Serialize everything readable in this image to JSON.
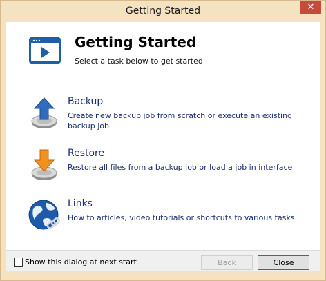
{
  "window": {
    "title": "Getting Started",
    "close_glyph": "✕"
  },
  "header": {
    "title": "Getting Started",
    "subtitle": "Select a task below to get started",
    "icon": "application-window-icon"
  },
  "tasks": [
    {
      "name": "Backup",
      "description": "Create new backup job from scratch or execute an existing backup job",
      "icon": "upload-arrow-icon",
      "color": "#2f6cc0"
    },
    {
      "name": "Restore",
      "description": "Restore all files from a backup job or load a job in interface",
      "icon": "download-arrow-icon",
      "color": "#f0901e"
    },
    {
      "name": "Links",
      "description": "How to articles, video tutorials or shortcuts to various tasks",
      "icon": "globe-link-icon",
      "color": "#1e5aa8"
    }
  ],
  "footer": {
    "show_dialog_label": "Show this dialog at next start",
    "show_dialog_checked": false,
    "back_label": "Back",
    "close_label": "Close"
  },
  "colors": {
    "titlebar": "#f4e2c0",
    "close_button": "#c74a3a",
    "link_text": "#1a2f6e"
  }
}
